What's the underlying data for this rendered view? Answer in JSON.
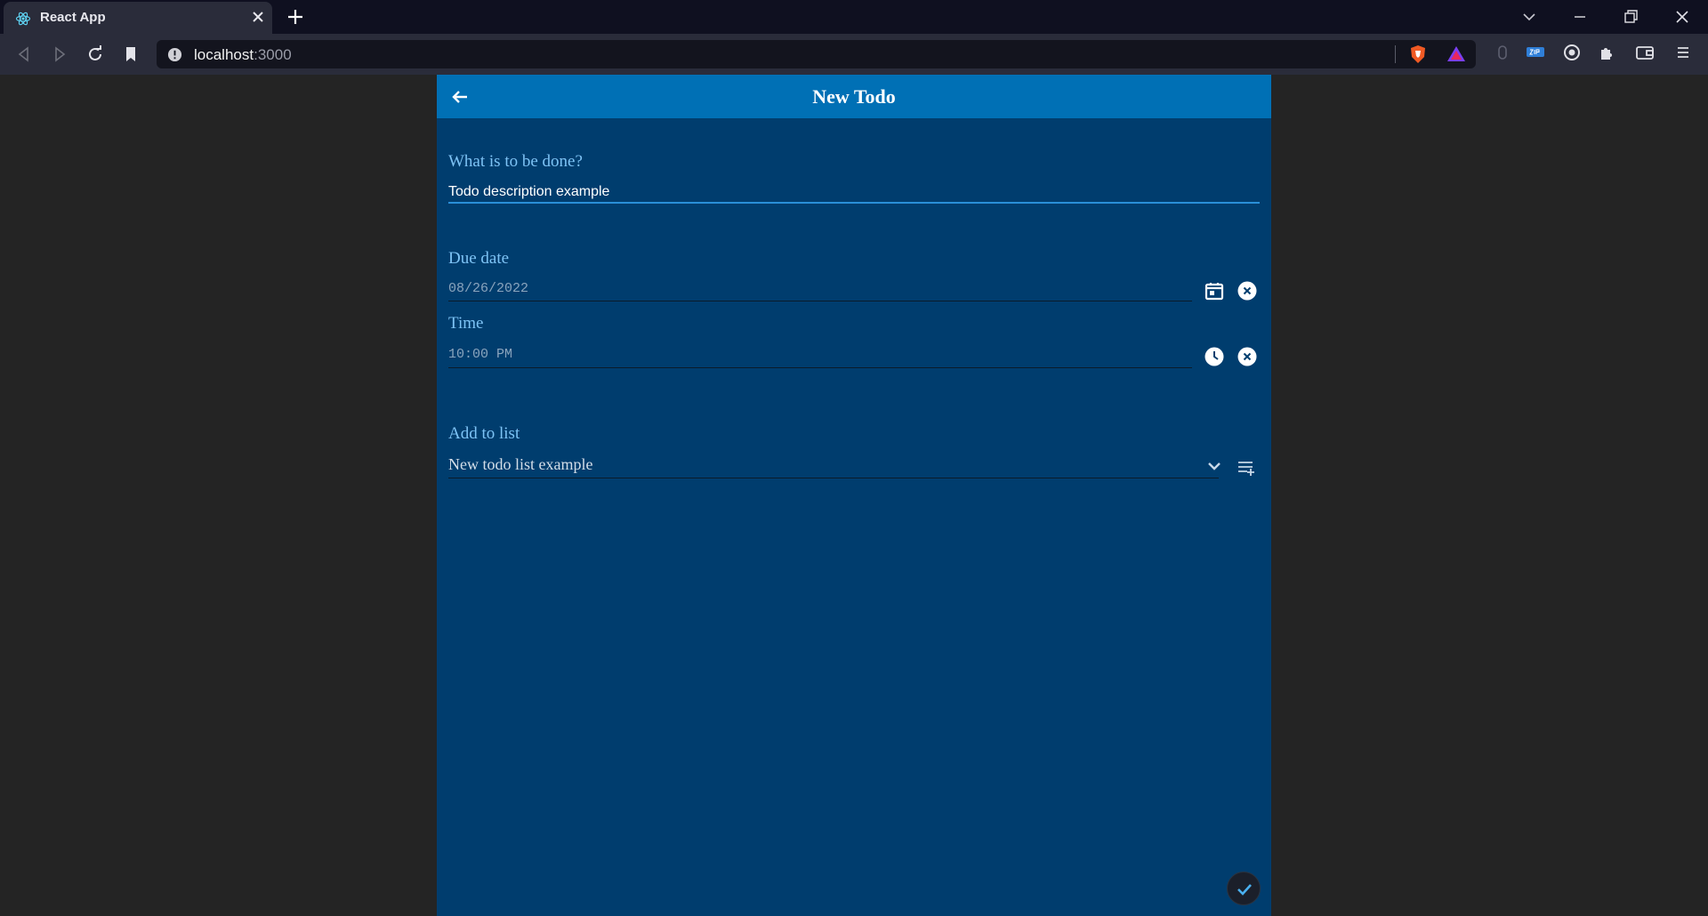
{
  "browser": {
    "tab_title": "React App",
    "url_host": "localhost",
    "url_port": ":3000"
  },
  "app": {
    "title": "New Todo",
    "description": {
      "label": "What is to be done?",
      "value": "Todo description example"
    },
    "due_date": {
      "label": "Due date",
      "value": "08/26/2022"
    },
    "time": {
      "label": "Time",
      "value": "10:00 PM"
    },
    "list": {
      "label": "Add to list",
      "selected": "New todo list example"
    }
  },
  "colors": {
    "appbar": "#0070b5",
    "background": "#003d6e",
    "label": "#7ec3f5",
    "active_underline": "#2a8fd8"
  },
  "icons": [
    "back-arrow-icon",
    "calendar-icon",
    "clear-icon",
    "clock-icon",
    "chevron-down-icon",
    "playlist-add-icon",
    "check-icon"
  ]
}
